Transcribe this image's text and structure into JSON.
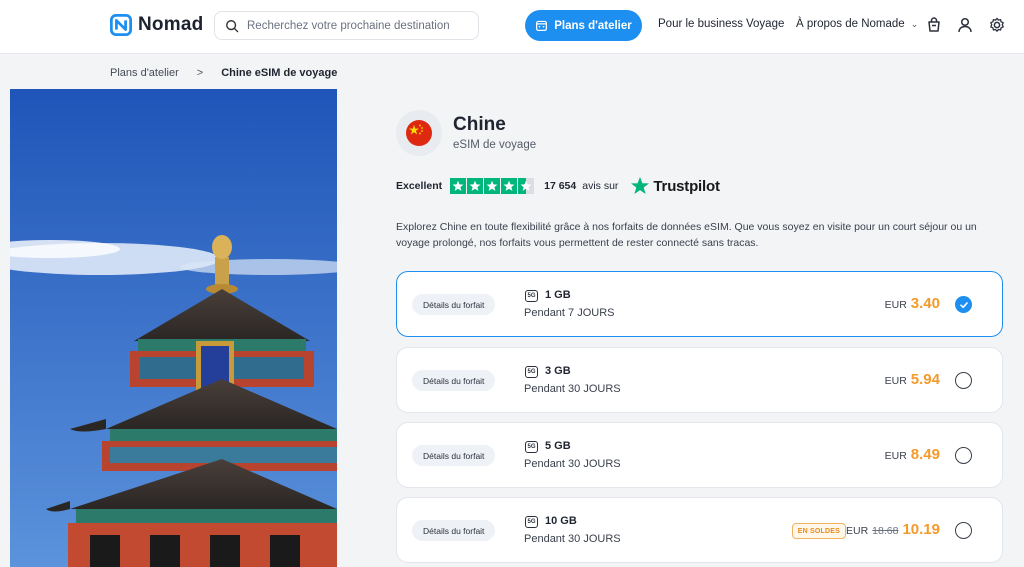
{
  "header": {
    "logo_text": "Nomad",
    "search_placeholder": "Recherchez votre prochaine destination",
    "cta_label": "Plans d'atelier",
    "nav": [
      "Pour le business",
      "Voyage",
      "À propos de Nomade"
    ],
    "icons": [
      "cart-icon",
      "user-icon",
      "settings-icon"
    ]
  },
  "breadcrumb": {
    "parent": "Plans d'atelier",
    "separator": ">",
    "current": "Chine eSIM de voyage"
  },
  "product": {
    "title": "Chine",
    "subtitle": "eSIM de voyage",
    "rating_label": "Excellent",
    "rating_stars": 4.5,
    "reviews_count": "17 654",
    "reviews_text": "avis sur",
    "trustpilot": "Trustpilot",
    "description": "Explorez Chine en toute flexibilité grâce à nos forfaits de données eSIM. Que vous soyez en visite pour un court séjour ou un voyage prolongé, nos forfaits vous permettent de rester connecté sans tracas."
  },
  "plans": [
    {
      "details_label": "Détails du forfait",
      "network": "5G",
      "data": "1 GB",
      "duration": "Pendant 7 JOURS",
      "currency": "EUR",
      "price": "3.40",
      "selected": true
    },
    {
      "details_label": "Détails du forfait",
      "network": "5G",
      "data": "3 GB",
      "duration": "Pendant 30 JOURS",
      "currency": "EUR",
      "price": "5.94",
      "selected": false
    },
    {
      "details_label": "Détails du forfait",
      "network": "5G",
      "data": "5 GB",
      "duration": "Pendant 30 JOURS",
      "currency": "EUR",
      "price": "8.49",
      "selected": false
    },
    {
      "details_label": "Détails du forfait",
      "network": "5G",
      "data": "10 GB",
      "duration": "Pendant 30 JOURS",
      "currency": "EUR",
      "old_price": "18.68",
      "price": "10.19",
      "badge": "EN SOLDES",
      "selected": false
    }
  ],
  "colors": {
    "accent": "#1d8ff0",
    "price": "#f39a2b",
    "trustpilot": "#00b67a"
  }
}
